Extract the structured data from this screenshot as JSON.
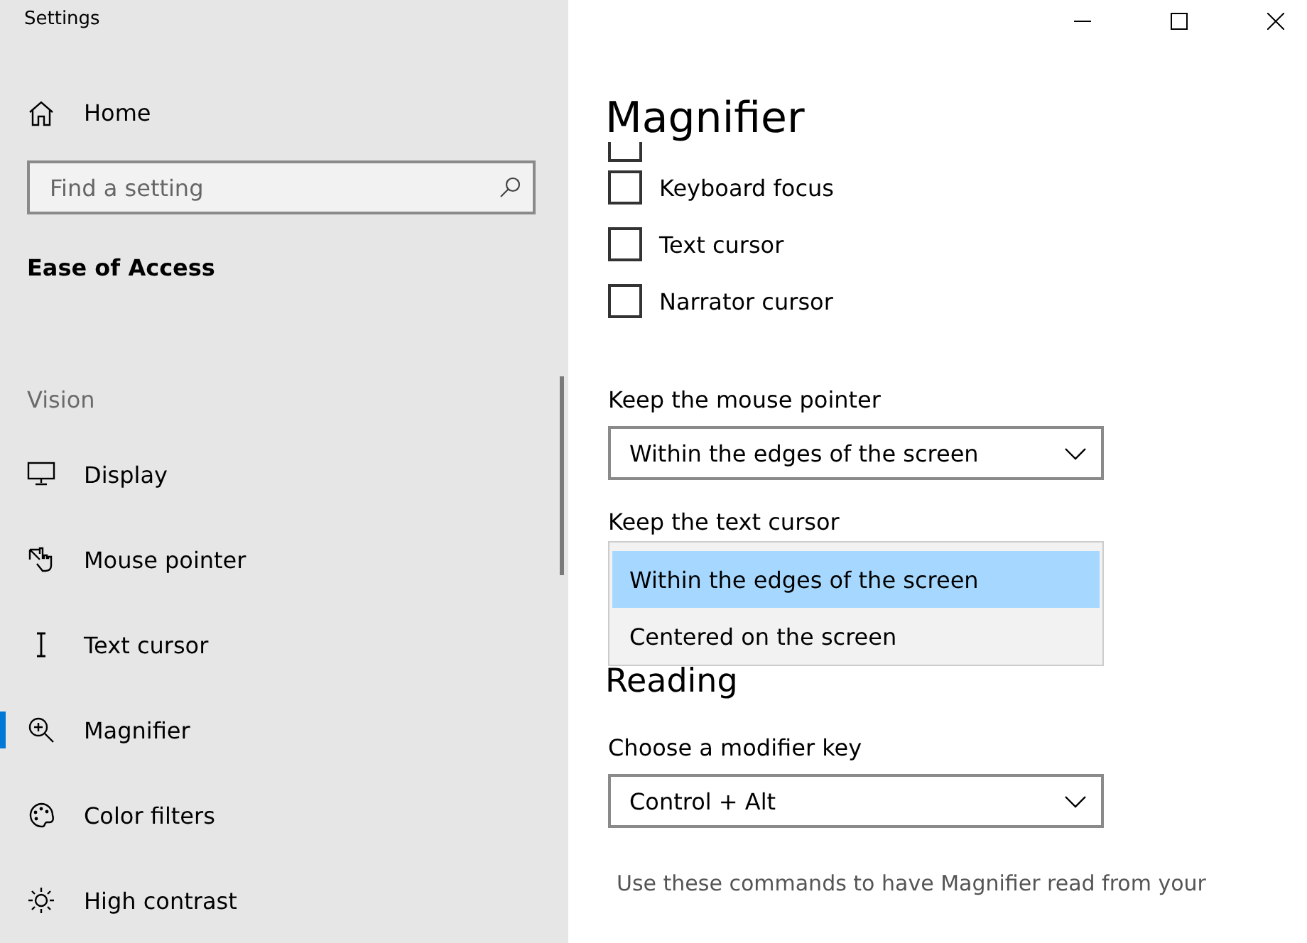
{
  "window": {
    "title": "Settings"
  },
  "sidebar": {
    "home": "Home",
    "search": {
      "placeholder": "Find a setting"
    },
    "section": "Ease of Access",
    "group": "Vision",
    "items": [
      {
        "label": "Display",
        "selected": false
      },
      {
        "label": "Mouse pointer",
        "selected": false
      },
      {
        "label": "Text cursor",
        "selected": false
      },
      {
        "label": "Magnifier",
        "selected": true
      },
      {
        "label": "Color filters",
        "selected": false
      },
      {
        "label": "High contrast",
        "selected": false
      }
    ]
  },
  "main": {
    "title": "Magnifier",
    "checkboxes": [
      {
        "checked": false
      },
      {
        "label": "Keyboard focus",
        "checked": false
      },
      {
        "label": "Text cursor",
        "checked": false
      },
      {
        "label": "Narrator cursor",
        "checked": false
      }
    ],
    "mouse_pointer": {
      "label": "Keep the mouse pointer",
      "value": "Within the edges of the screen"
    },
    "text_cursor": {
      "label": "Keep the text cursor",
      "expanded": true,
      "options": [
        {
          "label": "Within the edges of the screen",
          "selected": true
        },
        {
          "label": "Centered on the screen",
          "selected": false
        }
      ]
    },
    "reading": {
      "heading": "Reading",
      "modifier": {
        "label": "Choose a modifier key",
        "value": "Control + Alt"
      },
      "description": "Use these commands to have Magnifier read from your"
    }
  }
}
